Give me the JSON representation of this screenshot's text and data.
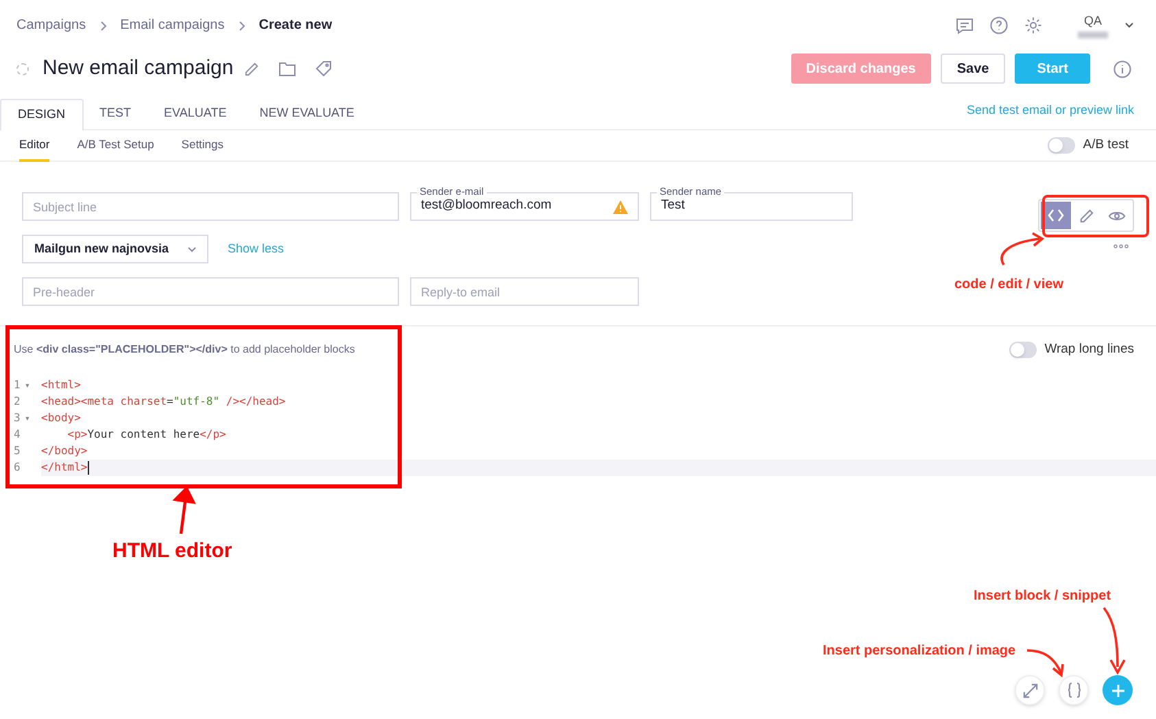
{
  "breadcrumbs": [
    {
      "label": "Campaigns",
      "current": false
    },
    {
      "label": "Email campaigns",
      "current": false
    },
    {
      "label": "Create new",
      "current": true
    }
  ],
  "user": {
    "initials": "QA"
  },
  "title": "New email campaign",
  "actions": [
    {
      "label": "Discard changes",
      "kind": "danger"
    },
    {
      "label": "Save",
      "kind": "default"
    },
    {
      "label": "Start",
      "kind": "primary"
    }
  ],
  "tabs": [
    {
      "label": "DESIGN",
      "selected": true
    },
    {
      "label": "TEST",
      "selected": false
    },
    {
      "label": "EVALUATE",
      "selected": false
    },
    {
      "label": "NEW EVALUATE",
      "selected": false
    }
  ],
  "send_test_link": "Send test email or preview link",
  "subtabs": [
    {
      "label": "Editor",
      "selected": true
    },
    {
      "label": "A/B Test Setup",
      "selected": false
    },
    {
      "label": "Settings",
      "selected": false
    }
  ],
  "ab_test": {
    "label": "A/B test",
    "on": false
  },
  "fields": {
    "subject": {
      "placeholder": "Subject line"
    },
    "sender_email": {
      "label": "Sender e-mail",
      "value": "test@bloomreach.com",
      "warning": true
    },
    "sender_name": {
      "label": "Sender name",
      "value": "Test"
    },
    "provider": {
      "value": "Mailgun new najnovsia"
    },
    "show_less": "Show less",
    "preheader": {
      "placeholder": "Pre-header"
    },
    "reply_to": {
      "placeholder": "Reply-to email"
    }
  },
  "view_modes": [
    {
      "kind": "code",
      "selected": true
    },
    {
      "kind": "edit",
      "selected": false
    },
    {
      "kind": "view",
      "selected": false
    }
  ],
  "editor": {
    "hint": "Use **<div class=\"PLACEHOLDER\"></div>** to add placeholder blocks",
    "wrap": {
      "label": "Wrap long lines",
      "on": false
    },
    "lines": [
      {
        "number": "1",
        "fold": "▾",
        "active": false,
        "tokens": [
          {
            "text": "<html>",
            "kind": "tag"
          }
        ]
      },
      {
        "number": "2",
        "active": false,
        "tokens": [
          {
            "text": "<head><meta ",
            "kind": "tag"
          },
          {
            "text": "charset",
            "kind": "attr"
          },
          {
            "text": "=",
            "kind": "plain"
          },
          {
            "text": "\"utf-8\"",
            "kind": "string"
          },
          {
            "text": " /></head>",
            "kind": "tag"
          }
        ]
      },
      {
        "number": "3",
        "fold": "▾",
        "active": false,
        "tokens": [
          {
            "text": "<body>",
            "kind": "tag"
          }
        ]
      },
      {
        "number": "4",
        "active": false,
        "tokens": [
          {
            "text": "    <p>",
            "kind": "tag"
          },
          {
            "text": "Your content here",
            "kind": "plain"
          },
          {
            "text": "</p>",
            "kind": "tag"
          }
        ]
      },
      {
        "number": "5",
        "active": false,
        "tokens": [
          {
            "text": "</body>",
            "kind": "tag"
          }
        ]
      },
      {
        "number": "6",
        "active": true,
        "tokens": [
          {
            "text": "</html>",
            "kind": "tag"
          }
        ]
      }
    ]
  },
  "annotations": [
    {
      "text": "code / edit / view"
    },
    {
      "text": "HTML editor"
    },
    {
      "text": "Insert block / snippet"
    },
    {
      "text": "Insert personalization / image"
    }
  ],
  "fab_buttons": [
    {
      "kind": "expand"
    },
    {
      "kind": "braces"
    },
    {
      "kind": "plus"
    }
  ]
}
